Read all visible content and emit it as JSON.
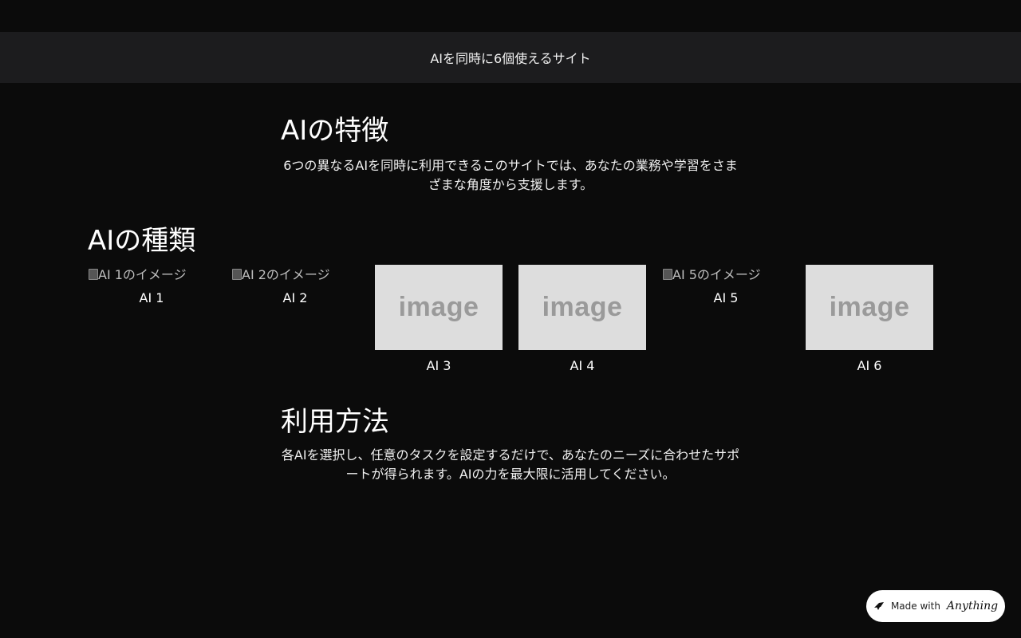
{
  "header": {
    "title": "AIを同時に6個使えるサイト"
  },
  "features": {
    "heading": "AIの特徴",
    "body": "6つの異なるAIを同時に利用できるこのサイトでは、あなたの業務や学習をさまざまな角度から支援します。"
  },
  "types": {
    "heading": "AIの種類",
    "items": [
      {
        "label": "AI 1",
        "image_alt": "AI 1のイメージ",
        "image_state": "broken"
      },
      {
        "label": "AI 2",
        "image_alt": "AI 2のイメージ",
        "image_state": "broken"
      },
      {
        "label": "AI 3",
        "image_text": "image",
        "image_state": "placeholder"
      },
      {
        "label": "AI 4",
        "image_text": "image",
        "image_state": "placeholder"
      },
      {
        "label": "AI 5",
        "image_alt": "AI 5のイメージ",
        "image_state": "broken"
      },
      {
        "label": "AI 6",
        "image_text": "image",
        "image_state": "placeholder"
      }
    ]
  },
  "usage": {
    "heading": "利用方法",
    "body": "各AIを選択し、任意のタスクを設定するだけで、あなたのニーズに合わせたサポートが得られます。AIの力を最大限に活用してください。"
  },
  "badge": {
    "made_with": "Made with",
    "brand": "Anything",
    "icon": "anything-logo-icon"
  },
  "colors": {
    "background": "#0b0b0b",
    "header_bar": "#1c1c1e",
    "placeholder": "#dddddd",
    "badge_bg": "#ffffff"
  }
}
